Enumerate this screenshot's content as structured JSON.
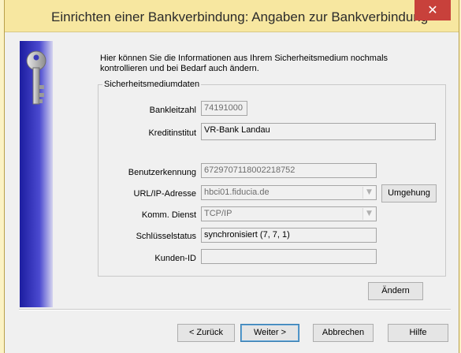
{
  "window": {
    "title": "Einrichten einer Bankverbindung: Angaben zur Bankverbindung",
    "close_glyph": "✕"
  },
  "intro_text": "Hier können Sie die Informationen aus Ihrem Sicherheitsmedium nochmals kontrollieren und bei Bedarf auch ändern.",
  "group": {
    "title": "Sicherheitsmediumdaten"
  },
  "fields": {
    "bankleitzahl": {
      "label": "Bankleitzahl",
      "value": "74191000"
    },
    "kreditinstitut": {
      "label": "Kreditinstitut",
      "value": "VR-Bank Landau"
    },
    "benutzerkennung": {
      "label": "Benutzerkennung",
      "value": "6729707118002218752"
    },
    "url": {
      "label": "URL/IP-Adresse",
      "value": "hbci01.fiducia.de"
    },
    "dienst": {
      "label": "Komm. Dienst",
      "value": "TCP/IP"
    },
    "schluesselstatus": {
      "label": "Schlüsselstatus",
      "value": "synchronisiert (7, 7, 1)"
    },
    "kunden_id": {
      "label": "Kunden-ID",
      "value": ""
    }
  },
  "buttons": {
    "umgehung": "Umgehung",
    "aendern": "Ändern",
    "zurueck": "< Zurück",
    "weiter": "Weiter >",
    "abbrechen": "Abbrechen",
    "hilfe": "Hilfe"
  },
  "icons": {
    "sidebar": "key-icon",
    "dropdown": "chevron-down-icon",
    "close": "close-icon"
  },
  "colors": {
    "titlebar": "#f7e7a0",
    "close_button": "#c8413b",
    "sidebar_dark": "#1c1da0",
    "default_button_border": "#3c7fb1"
  }
}
